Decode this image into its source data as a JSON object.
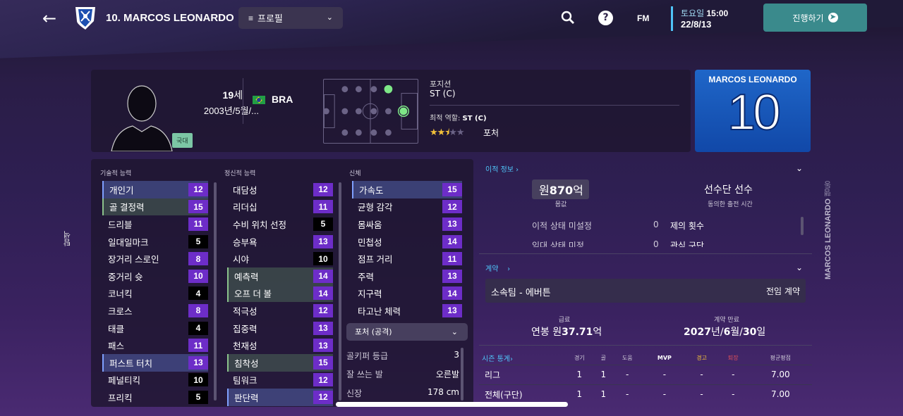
{
  "header": {
    "player_title": "10. MARCOS LEONARDO",
    "view_dropdown": "프로필",
    "fm_label": "FM",
    "date_day": "토요일",
    "date_time": "15:00",
    "date": "22/8/13",
    "continue_label": "진행하기"
  },
  "profile": {
    "age": "19",
    "age_suffix": "세",
    "dob": "2003년/5월/...",
    "national_badge": "국대",
    "nationality": "BRA",
    "position_label": "포지션",
    "position_value": "ST (C)",
    "best_role_label": "최적 역할:",
    "best_role_value": "ST (C)",
    "role_name": "포처",
    "role_stars": 2.5
  },
  "shirt": {
    "name": "MARCOS LEONARDO",
    "number": "10"
  },
  "side_left": "탐색",
  "side_right_name": "MARCOS LEONARDO",
  "side_right_label": "행동",
  "attributes": {
    "technical_title": "기술적 능력",
    "mental_title": "정신적 능력",
    "physical_title": "신체",
    "technical": [
      {
        "label": "개인기",
        "value": "12",
        "style": "p",
        "hl": "hl"
      },
      {
        "label": "골 결정력",
        "value": "15",
        "style": "p",
        "hl": "hg"
      },
      {
        "label": "드리블",
        "value": "11",
        "style": "p",
        "hl": ""
      },
      {
        "label": "일대일마크",
        "value": "5",
        "style": "b",
        "hl": ""
      },
      {
        "label": "장거리 스로인",
        "value": "8",
        "style": "p",
        "hl": ""
      },
      {
        "label": "중거리 슛",
        "value": "10",
        "style": "p",
        "hl": ""
      },
      {
        "label": "코너킥",
        "value": "4",
        "style": "b",
        "hl": ""
      },
      {
        "label": "크로스",
        "value": "8",
        "style": "p",
        "hl": ""
      },
      {
        "label": "태클",
        "value": "4",
        "style": "b",
        "hl": ""
      },
      {
        "label": "패스",
        "value": "11",
        "style": "p",
        "hl": ""
      },
      {
        "label": "퍼스트 터치",
        "value": "13",
        "style": "p",
        "hl": "hl"
      },
      {
        "label": "페널티킥",
        "value": "10",
        "style": "b",
        "hl": ""
      },
      {
        "label": "프리킥",
        "value": "5",
        "style": "b",
        "hl": ""
      }
    ],
    "mental": [
      {
        "label": "대담성",
        "value": "12",
        "style": "p",
        "hl": ""
      },
      {
        "label": "리더십",
        "value": "11",
        "style": "p",
        "hl": ""
      },
      {
        "label": "수비 위치 선정",
        "value": "5",
        "style": "b",
        "hl": ""
      },
      {
        "label": "승부욕",
        "value": "13",
        "style": "p",
        "hl": ""
      },
      {
        "label": "시야",
        "value": "10",
        "style": "b",
        "hl": ""
      },
      {
        "label": "예측력",
        "value": "14",
        "style": "p",
        "hl": "hg"
      },
      {
        "label": "오프 더 볼",
        "value": "14",
        "style": "p",
        "hl": "hg"
      },
      {
        "label": "적극성",
        "value": "12",
        "style": "p",
        "hl": ""
      },
      {
        "label": "집중력",
        "value": "13",
        "style": "p",
        "hl": ""
      },
      {
        "label": "천재성",
        "value": "13",
        "style": "p",
        "hl": ""
      },
      {
        "label": "침착성",
        "value": "15",
        "style": "p",
        "hl": "hg"
      },
      {
        "label": "팀워크",
        "value": "12",
        "style": "p",
        "hl": ""
      },
      {
        "label": "판단력",
        "value": "12",
        "style": "p",
        "hl": "hl"
      }
    ],
    "physical": [
      {
        "label": "가속도",
        "value": "15",
        "style": "p",
        "hl": "hl"
      },
      {
        "label": "균형 감각",
        "value": "12",
        "style": "p",
        "hl": ""
      },
      {
        "label": "몸싸움",
        "value": "13",
        "style": "p",
        "hl": ""
      },
      {
        "label": "민첩성",
        "value": "14",
        "style": "p",
        "hl": ""
      },
      {
        "label": "점프 거리",
        "value": "11",
        "style": "p",
        "hl": ""
      },
      {
        "label": "주력",
        "value": "13",
        "style": "p",
        "hl": ""
      },
      {
        "label": "지구력",
        "value": "14",
        "style": "p",
        "hl": ""
      },
      {
        "label": "타고난 체력",
        "value": "13",
        "style": "p",
        "hl": ""
      }
    ],
    "role_selector": "포처 (공격)",
    "extras": [
      {
        "label": "골키퍼 등급",
        "value": "3"
      },
      {
        "label": "잘 쓰는 발",
        "value": "오른발"
      },
      {
        "label": "신장",
        "value": "178 cm"
      }
    ]
  },
  "transfer": {
    "title": "이적 정보",
    "value_currency": "원",
    "value_amount": "870",
    "value_unit": "억",
    "value_caption": "몸값",
    "squad_status": "선수단 선수",
    "squad_caption": "동의한 출전 시간",
    "status_label": "이적 상태 미설정",
    "status_count": "0",
    "offers_label": "제의 횟수",
    "hidden_row_label": "임대 상태 미정",
    "hidden_row_count": "0",
    "hidden_row_right": "관심 구단"
  },
  "contract": {
    "title": "계약",
    "club": "소속팀 - 에버튼",
    "type": "전임 계약",
    "wage_caption": "급료",
    "wage_prefix": "연봉 원",
    "wage_amount": "37.71",
    "wage_unit": "억",
    "expiry_caption": "계약 만료",
    "expiry_y": "2027",
    "expiry_y_suffix": "년/",
    "expiry_m": "6",
    "expiry_m_suffix": "월/",
    "expiry_d": "30",
    "expiry_d_suffix": "일"
  },
  "season_stats": {
    "title": "시즌 통계",
    "columns": [
      "경기",
      "골",
      "도움",
      "MVP",
      "경고",
      "퇴장",
      "평균평점"
    ],
    "rows": [
      {
        "label": "리그",
        "values": [
          "1",
          "1",
          "-",
          "-",
          "-",
          "-",
          "7.00"
        ]
      },
      {
        "label": "전체(구단)",
        "values": [
          "1",
          "1",
          "-",
          "-",
          "-",
          "-",
          "7.00"
        ]
      }
    ]
  },
  "colors": {
    "accent": "#4fc3f7",
    "attr_purple": "#6d2dc8",
    "continue_button": "#3a8a8c",
    "yellow_card": "#f3c13a",
    "red_card": "#e0505a"
  }
}
